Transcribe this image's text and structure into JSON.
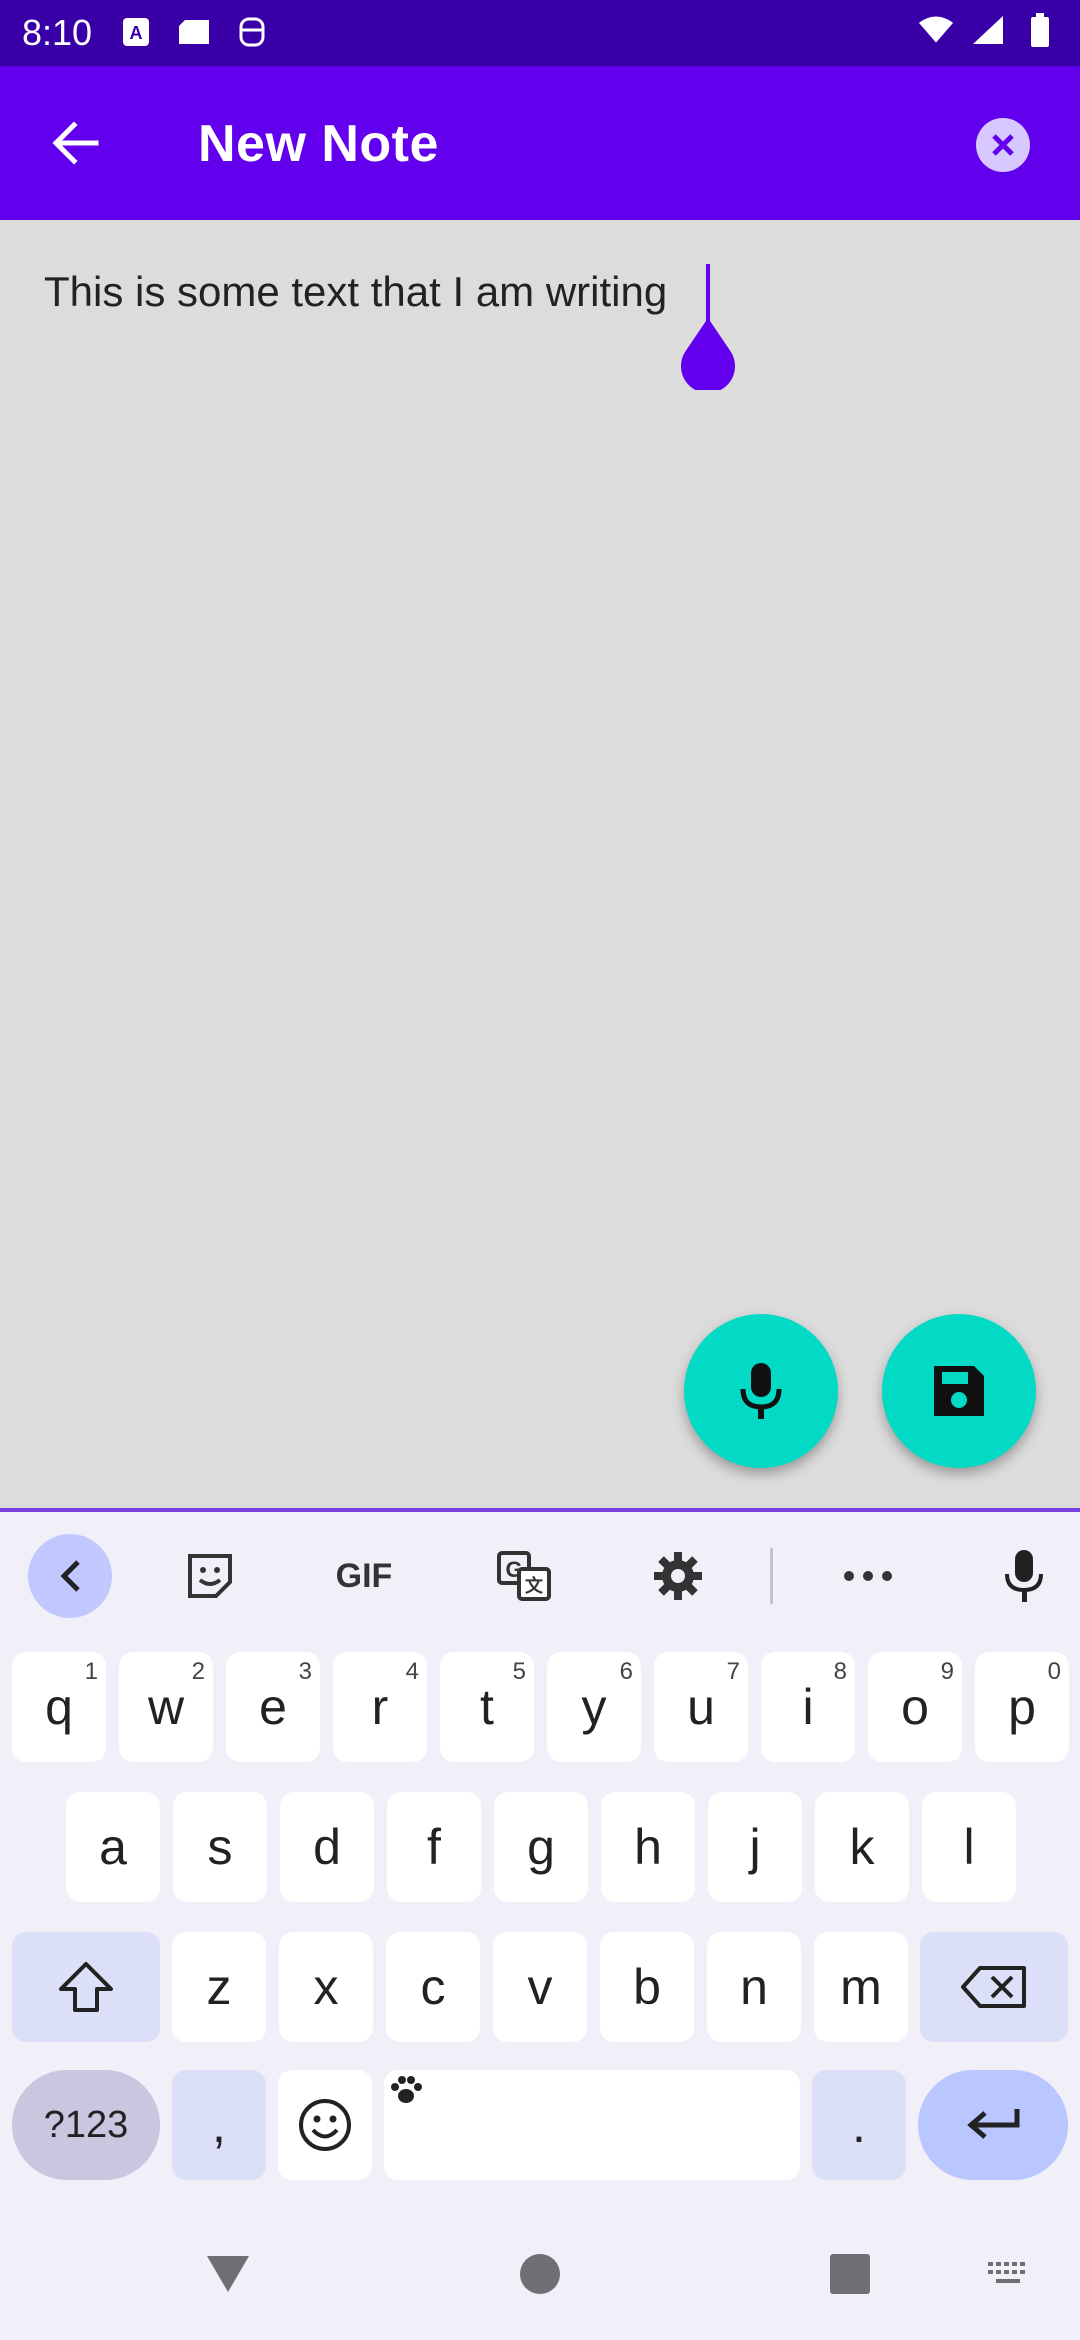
{
  "status_bar": {
    "time": "8:10",
    "left_icons": [
      "font-a-icon",
      "sd-card-icon",
      "face-icon"
    ],
    "right_icons": [
      "wifi-icon",
      "signal-icon",
      "battery-icon"
    ]
  },
  "app_bar": {
    "title": "New Note",
    "back_icon": "arrow-back-icon",
    "close_icon": "close-icon",
    "color": "#6200ee"
  },
  "editor": {
    "text": "This is some text that I am writing",
    "caret_color": "#6200ee"
  },
  "fabs": {
    "mic_icon": "mic-icon",
    "save_icon": "save-icon",
    "color": "#03dac5"
  },
  "keyboard": {
    "toolbar": {
      "collapse_icon": "chevron-left-icon",
      "sticker_icon": "sticker-icon",
      "gif_label": "GIF",
      "translate_icon": "translate-icon",
      "settings_icon": "gear-icon",
      "more_icon": "more-horiz-icon",
      "voice_icon": "mic-icon"
    },
    "row1": [
      {
        "k": "q",
        "h": "1"
      },
      {
        "k": "w",
        "h": "2"
      },
      {
        "k": "e",
        "h": "3"
      },
      {
        "k": "r",
        "h": "4"
      },
      {
        "k": "t",
        "h": "5"
      },
      {
        "k": "y",
        "h": "6"
      },
      {
        "k": "u",
        "h": "7"
      },
      {
        "k": "i",
        "h": "8"
      },
      {
        "k": "o",
        "h": "9"
      },
      {
        "k": "p",
        "h": "0"
      }
    ],
    "row2": [
      "a",
      "s",
      "d",
      "f",
      "g",
      "h",
      "j",
      "k",
      "l"
    ],
    "row3": [
      "z",
      "x",
      "c",
      "v",
      "b",
      "n",
      "m"
    ],
    "bottom": {
      "symbols_label": "?123",
      "comma_label": ",",
      "period_label": ".",
      "emoji_icon": "emoji-icon",
      "space_icon": "paw-icon",
      "enter_icon": "enter-arrow-icon",
      "shift_icon": "shift-icon",
      "backspace_icon": "backspace-icon"
    }
  },
  "nav_bar": {
    "back_icon": "nav-back-icon",
    "home_icon": "nav-home-icon",
    "recents_icon": "nav-recents-icon",
    "keyboard_icon": "keyboard-icon"
  }
}
